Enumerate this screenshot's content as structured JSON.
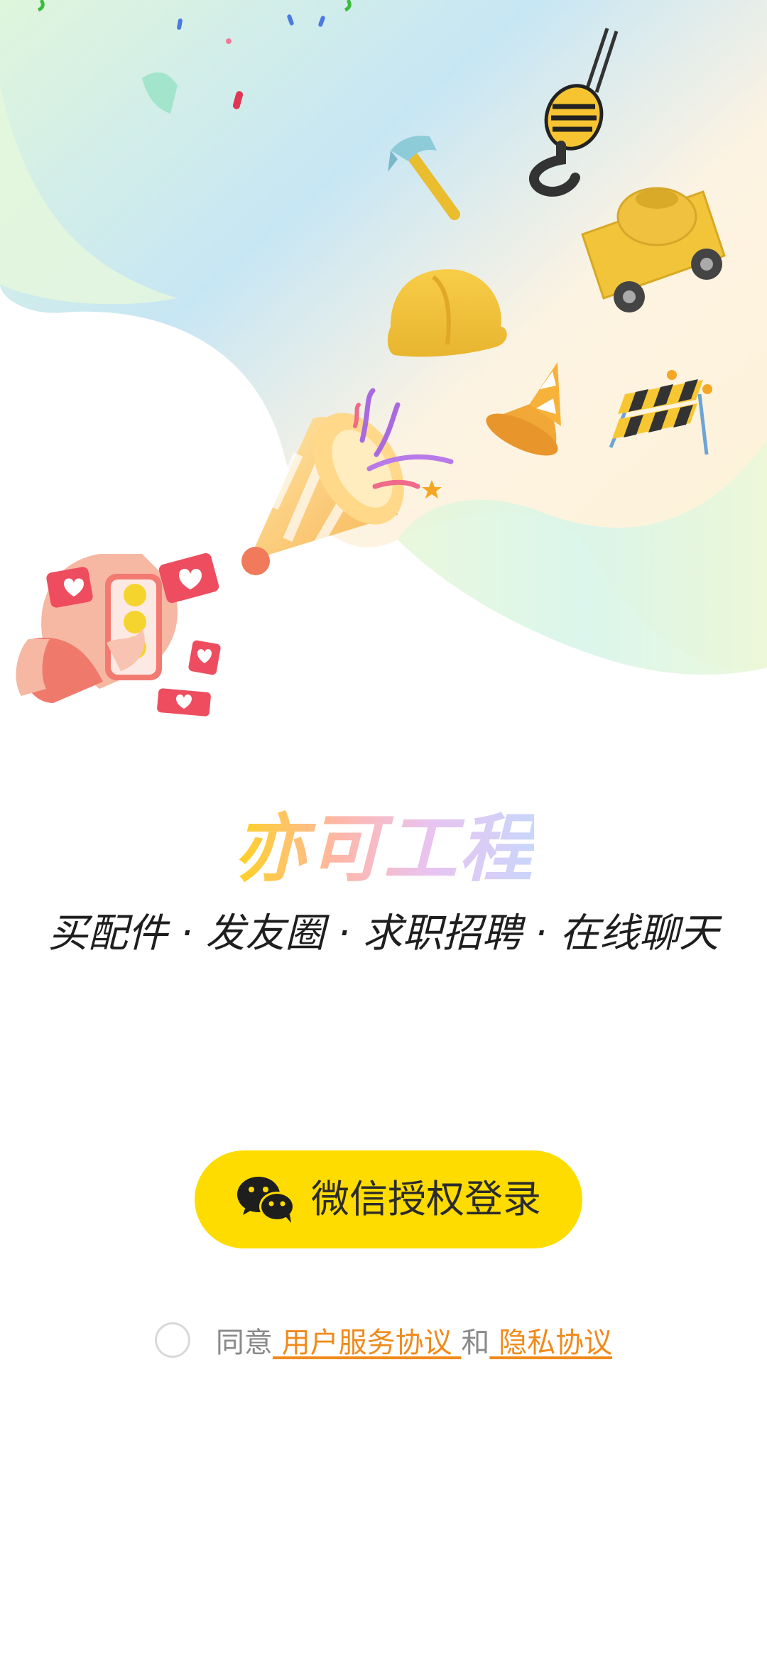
{
  "brand": {
    "title": "亦可工程",
    "tagline": "买配件 · 发友圈 · 求职招聘 · 在线聊天",
    "gradient_colors": [
      "#ffd21f",
      "#ffb6a8",
      "#e9c3f0",
      "#c9d6fb"
    ]
  },
  "login": {
    "button_label": "微信授权登录",
    "button_color": "#ffdc00",
    "icon": "wechat-icon"
  },
  "agreement": {
    "prefix": "同意",
    "service_link": " 用户服务协议 ",
    "conjunction": "和",
    "privacy_link": " 隐私协议",
    "checked": false,
    "link_color": "#f08a1c"
  },
  "illustration": {
    "icons": [
      "confetti-icon",
      "crane-hook-icon",
      "hammer-icon",
      "cement-mixer-icon",
      "hard-hat-icon",
      "traffic-cone-icon",
      "road-barrier-icon",
      "party-popper-icon",
      "hand-phone-icon",
      "heart-bubble-icon"
    ]
  }
}
